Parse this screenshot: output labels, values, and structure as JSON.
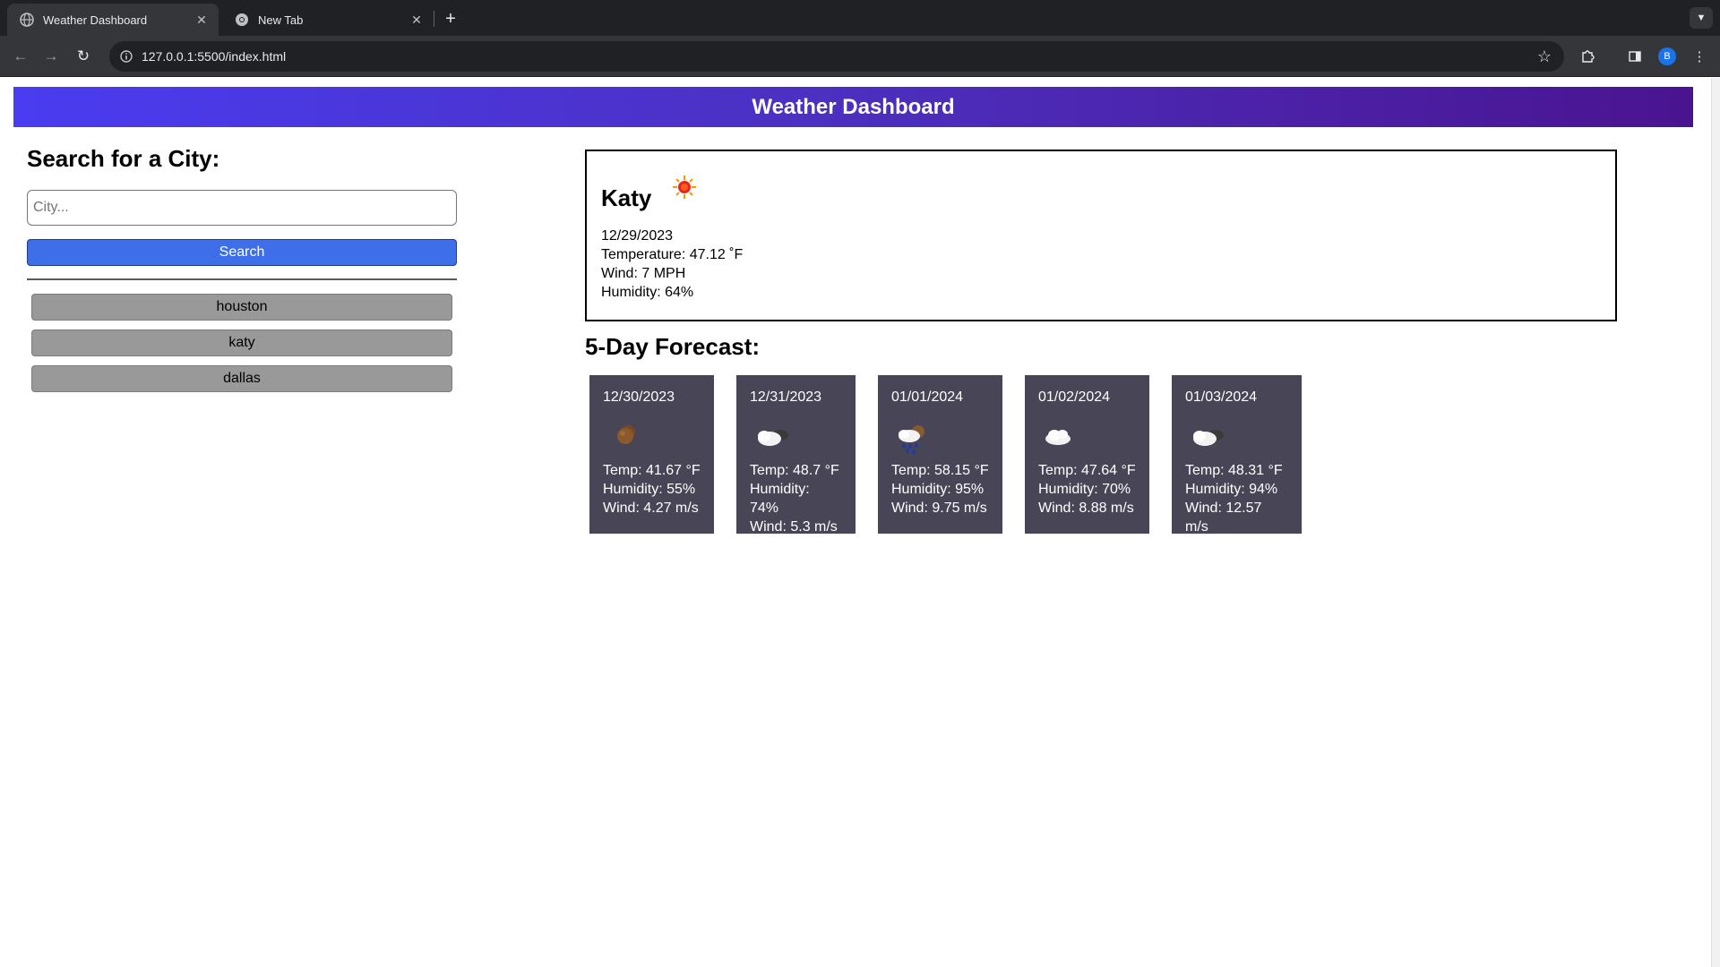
{
  "browser": {
    "tabs": [
      {
        "title": "Weather Dashboard",
        "active": true
      },
      {
        "title": "New Tab",
        "active": false
      }
    ],
    "url": "127.0.0.1:5500/index.html",
    "profile_initial": "B"
  },
  "header": {
    "title": "Weather Dashboard"
  },
  "sidebar": {
    "heading": "Search for a City:",
    "search_placeholder": "City...",
    "search_button": "Search",
    "history": [
      "houston",
      "katy",
      "dallas"
    ]
  },
  "current": {
    "city": "Katy",
    "icon": "sun-icon",
    "date": "12/29/2023",
    "temperature": "Temperature: 47.12 ˚F",
    "wind": "Wind: 7 MPH",
    "humidity": "Humidity: 64%"
  },
  "forecast": {
    "title": "5-Day Forecast:",
    "days": [
      {
        "date": "12/30/2023",
        "icon": "moon-icon",
        "temp": "Temp: 41.67 °F",
        "humidity": "Humidity: 55%",
        "wind": "Wind: 4.27 m/s"
      },
      {
        "date": "12/31/2023",
        "icon": "night-cloud-icon",
        "temp": "Temp: 48.7 °F",
        "humidity": "Humidity: 74%",
        "wind": "Wind: 5.3 m/s"
      },
      {
        "date": "01/01/2024",
        "icon": "rain-cloud-icon",
        "temp": "Temp: 58.15 °F",
        "humidity": "Humidity: 95%",
        "wind": "Wind: 9.75 m/s"
      },
      {
        "date": "01/02/2024",
        "icon": "cloud-icon",
        "temp": "Temp: 47.64 °F",
        "humidity": "Humidity: 70%",
        "wind": "Wind: 8.88 m/s"
      },
      {
        "date": "01/03/2024",
        "icon": "night-cloud-icon",
        "temp": "Temp: 48.31 °F",
        "humidity": "Humidity: 94%",
        "wind": "Wind: 12.57 m/s"
      }
    ]
  },
  "colors": {
    "header_start": "#4a3cf0",
    "header_end": "#4a1490",
    "search_button": "#3f6fe8",
    "history_button": "#999999",
    "forecast_card": "#484656"
  }
}
